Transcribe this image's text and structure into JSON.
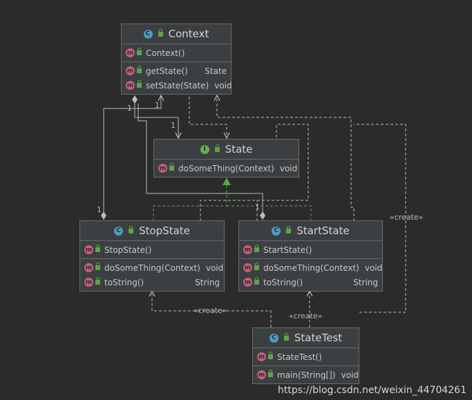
{
  "classes": {
    "context": {
      "name": "Context",
      "kind_icon": "C",
      "constructors": [
        {
          "name": "Context()",
          "type": ""
        }
      ],
      "methods": [
        {
          "name": "getState()",
          "type": "State"
        },
        {
          "name": "setState(State)",
          "type": "void"
        }
      ]
    },
    "state": {
      "name": "State",
      "kind_icon": "I",
      "constructors": [],
      "methods": [
        {
          "name": "doSomeThing(Context)",
          "type": "void"
        }
      ]
    },
    "stopstate": {
      "name": "StopState",
      "kind_icon": "C",
      "constructors": [
        {
          "name": "StopState()",
          "type": ""
        }
      ],
      "methods": [
        {
          "name": "doSomeThing(Context)",
          "type": "void"
        },
        {
          "name": "toString()",
          "type": "String"
        }
      ]
    },
    "startstate": {
      "name": "StartState",
      "kind_icon": "C",
      "constructors": [
        {
          "name": "StartState()",
          "type": ""
        }
      ],
      "methods": [
        {
          "name": "doSomeThing(Context)",
          "type": "void"
        },
        {
          "name": "toString()",
          "type": "String"
        }
      ]
    },
    "statetest": {
      "name": "StateTest",
      "kind_icon": "C",
      "constructors": [
        {
          "name": "StateTest()",
          "type": ""
        }
      ],
      "methods": [
        {
          "name": "main(String[])",
          "type": "void"
        }
      ]
    }
  },
  "labels": {
    "create_1": "«create»",
    "create_2": "«create»",
    "create_3": "«create»",
    "mult_1": "1",
    "mult_2": "1",
    "mult_3": "1",
    "mult_4": "1",
    "mult_5": "1"
  },
  "watermark": "https://blog.csdn.net/weixin_44704261",
  "colors": {
    "background": "#2b2b2b",
    "box": "#3c3f41",
    "line": "#bdbdbd",
    "realization": "#5ca64a"
  }
}
